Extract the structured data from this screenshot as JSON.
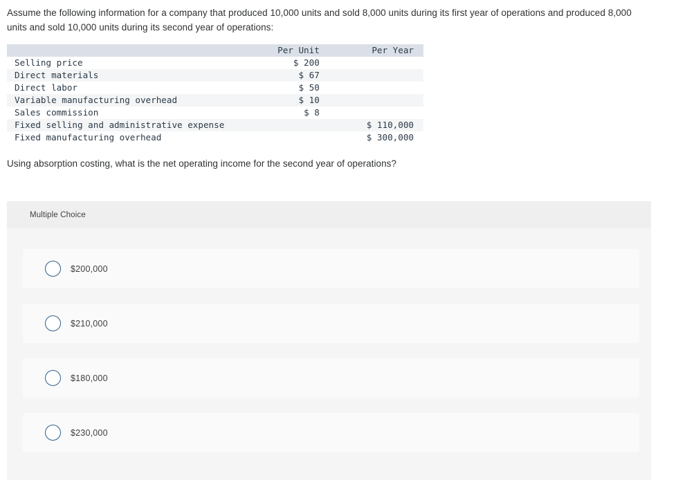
{
  "intro": {
    "text": "Assume the following information for a company that produced 10,000 units and sold 8,000 units during its first year of operations and produced 8,000 units and sold 10,000 units during its second year of operations:"
  },
  "table": {
    "headers": {
      "label": "",
      "per_unit": "Per Unit",
      "per_year": "Per Year"
    },
    "rows": [
      {
        "label": "Selling price",
        "per_unit": "$ 200",
        "per_year": ""
      },
      {
        "label": "Direct materials",
        "per_unit": "$ 67",
        "per_year": ""
      },
      {
        "label": "Direct labor",
        "per_unit": "$ 50",
        "per_year": ""
      },
      {
        "label": "Variable manufacturing overhead",
        "per_unit": "$ 10",
        "per_year": ""
      },
      {
        "label": "Sales commission",
        "per_unit": "$ 8",
        "per_year": ""
      },
      {
        "label": "Fixed selling and administrative expense",
        "per_unit": "",
        "per_year": "$ 110,000"
      },
      {
        "label": "Fixed manufacturing overhead",
        "per_unit": "",
        "per_year": "$ 300,000"
      }
    ]
  },
  "prompt": {
    "text": "Using absorption costing, what is the net operating income for the second year of operations?"
  },
  "answers": {
    "header_label": "Multiple Choice",
    "options": [
      {
        "label": "$200,000",
        "selected": false
      },
      {
        "label": "$210,000",
        "selected": false
      },
      {
        "label": "$180,000",
        "selected": false
      },
      {
        "label": "$230,000",
        "selected": false
      }
    ]
  },
  "colors": {
    "page_background": "#ffffff",
    "text": "#2f3133",
    "table_header_background": "#dbe0e8",
    "table_row_shaded": "#f4f5f6",
    "panel_background": "#f5f5f5",
    "panel_header_background": "#efefef",
    "option_card_background": "#fafafa",
    "radio_border": "#2e5f8c"
  }
}
